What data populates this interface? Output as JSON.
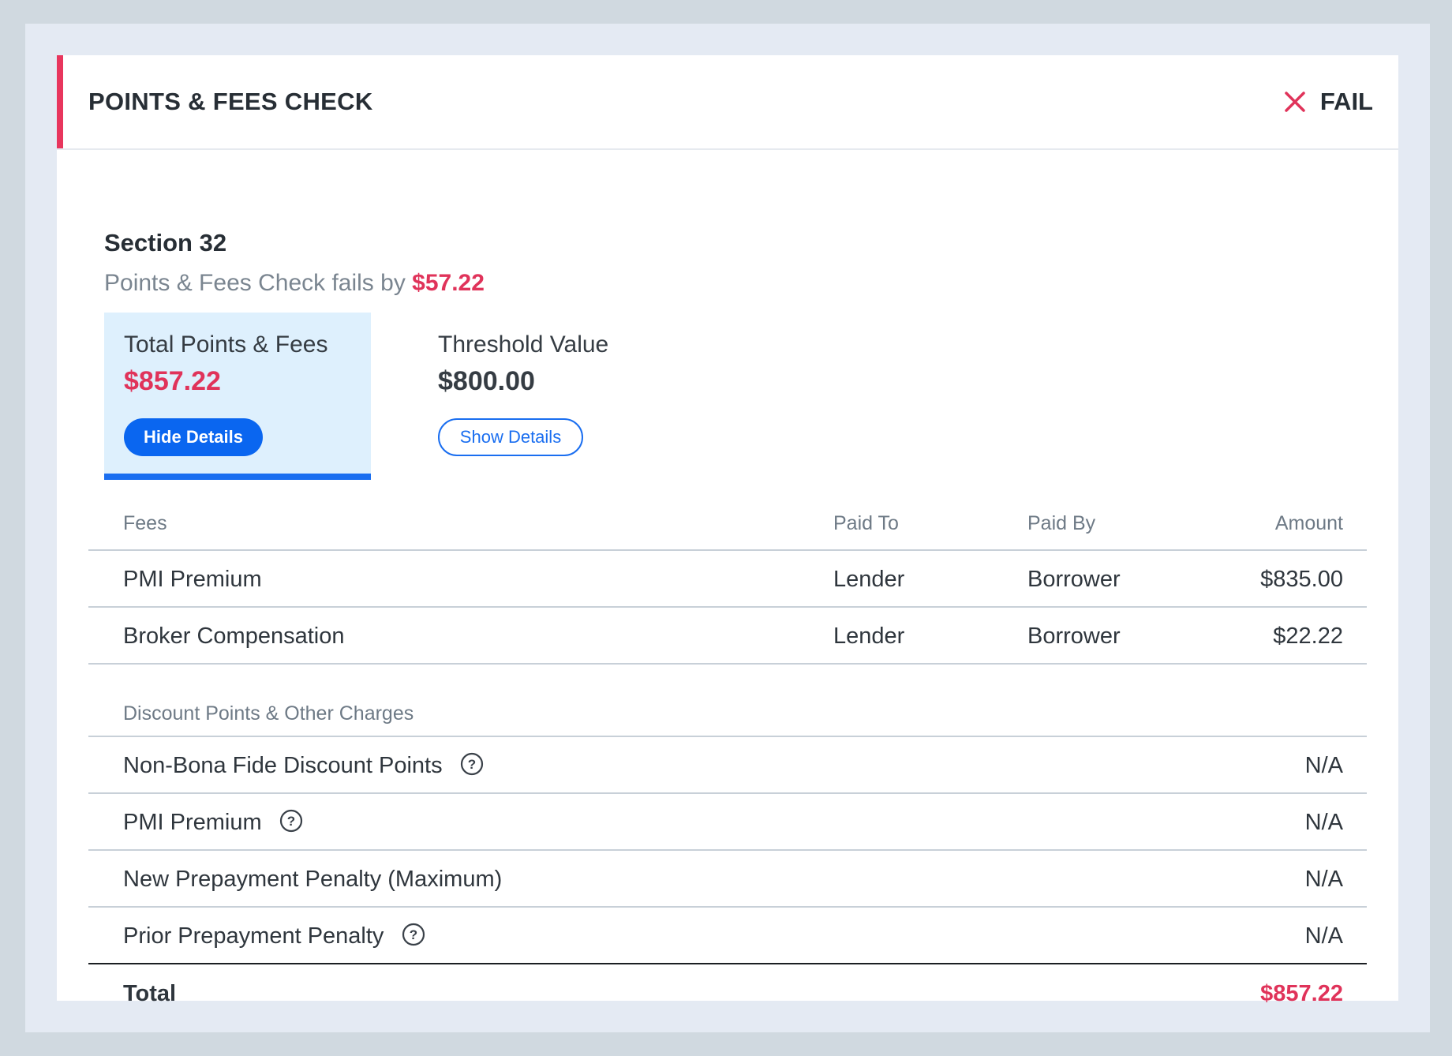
{
  "header": {
    "title": "POINTS & FEES CHECK",
    "status_label": "FAIL",
    "status_icon": "close-x-icon",
    "accent_color": "#e8365d"
  },
  "section": {
    "title": "Section 32",
    "subtitle_prefix": "Points & Fees Check fails by",
    "fail_amount": "$57.22"
  },
  "metrics": {
    "total": {
      "label": "Total Points & Fees",
      "value": "$857.22",
      "button": "Hide Details"
    },
    "threshold": {
      "label": "Threshold Value",
      "value": "$800.00",
      "button": "Show Details"
    }
  },
  "table": {
    "headers": {
      "fees": "Fees",
      "paid_to": "Paid To",
      "paid_by": "Paid By",
      "amount": "Amount"
    },
    "fees": [
      {
        "name": "PMI Premium",
        "paid_to": "Lender",
        "paid_by": "Borrower",
        "amount": "$835.00"
      },
      {
        "name": "Broker Compensation",
        "paid_to": "Lender",
        "paid_by": "Borrower",
        "amount": "$22.22"
      }
    ],
    "group_label": "Discount Points & Other Charges",
    "other": [
      {
        "name": "Non-Bona Fide Discount Points",
        "amount": "N/A",
        "help": true
      },
      {
        "name": "PMI Premium",
        "amount": "N/A",
        "help": true
      },
      {
        "name": "New Prepayment Penalty (Maximum)",
        "amount": "N/A",
        "help": false
      },
      {
        "name": "Prior Prepayment Penalty",
        "amount": "N/A",
        "help": true
      }
    ],
    "total_label": "Total",
    "total_amount": "$857.22"
  },
  "colors": {
    "fail_red": "#e0335a",
    "primary_blue": "#0a66f0",
    "active_bg": "#def0fd"
  }
}
